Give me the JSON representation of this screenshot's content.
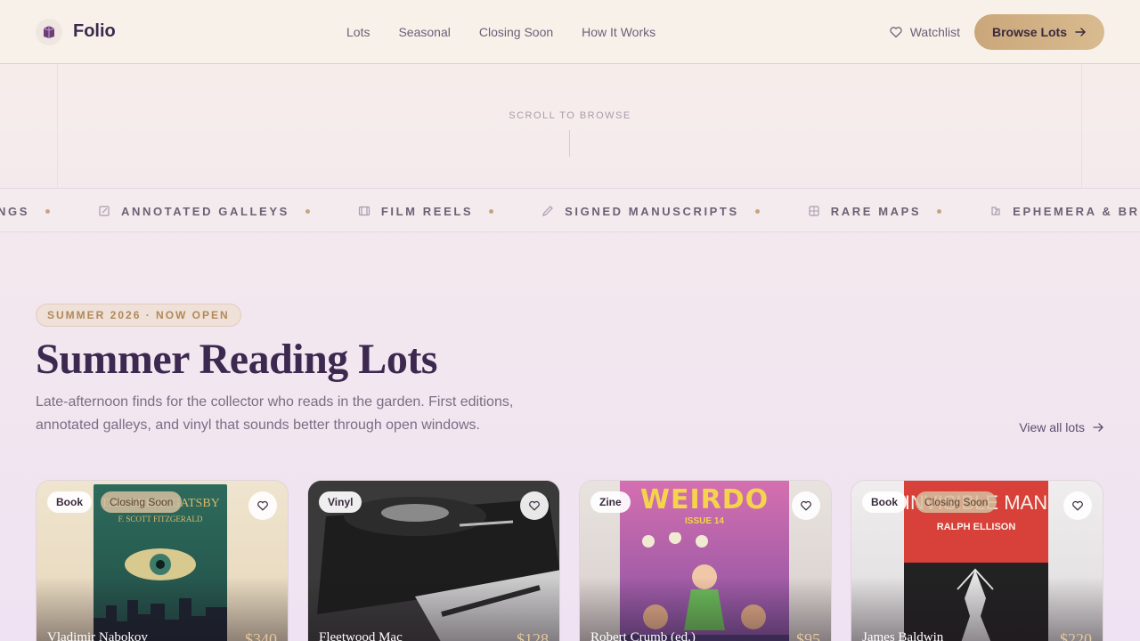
{
  "header": {
    "brand": "Folio",
    "nav": [
      "Lots",
      "Seasonal",
      "Closing Soon",
      "How It Works"
    ],
    "watchlist_label": "Watchlist",
    "browse_label": "Browse Lots"
  },
  "hero": {
    "scroll_hint": "SCROLL TO BROWSE"
  },
  "marquee": {
    "items": [
      {
        "label": "NGS",
        "icon": "none"
      },
      {
        "label": "ANNOTATED GALLEYS",
        "icon": "note-icon"
      },
      {
        "label": "FILM REELS",
        "icon": "film-icon"
      },
      {
        "label": "SIGNED MANUSCRIPTS",
        "icon": "pen-icon"
      },
      {
        "label": "RARE MAPS",
        "icon": "map-icon"
      },
      {
        "label": "EPHEMERA & BROADS",
        "icon": "puzzle-icon"
      }
    ]
  },
  "section": {
    "pill": "SUMMER 2026 · NOW OPEN",
    "title": "Summer Reading Lots",
    "subtitle": "Late-afternoon finds for the collector who reads in the garden. First editions, annotated galleys, and vinyl that sounds better through open windows.",
    "view_all": "View all lots"
  },
  "cards": [
    {
      "type": "Book",
      "closing": "Closing Soon",
      "author": "Vladimir Nabokov",
      "price": "$340",
      "cover_text": [
        "THE GREAT GATSBY",
        "F. SCOTT FITZGERALD"
      ]
    },
    {
      "type": "Vinyl",
      "closing": "",
      "author": "Fleetwood Mac",
      "price": "$128",
      "cover_text": []
    },
    {
      "type": "Zine",
      "closing": "",
      "author": "Robert Crumb (ed.)",
      "price": "$95",
      "cover_text": [
        "WEIRDO",
        "ISSUE 14"
      ]
    },
    {
      "type": "Book",
      "closing": "Closing Soon",
      "author": "James Baldwin",
      "price": "$220",
      "cover_text": [
        "INVISIBLE MAN",
        "RALPH ELLISON"
      ]
    }
  ],
  "colors": {
    "accent": "#caa77a",
    "brand": "#3d2850"
  }
}
